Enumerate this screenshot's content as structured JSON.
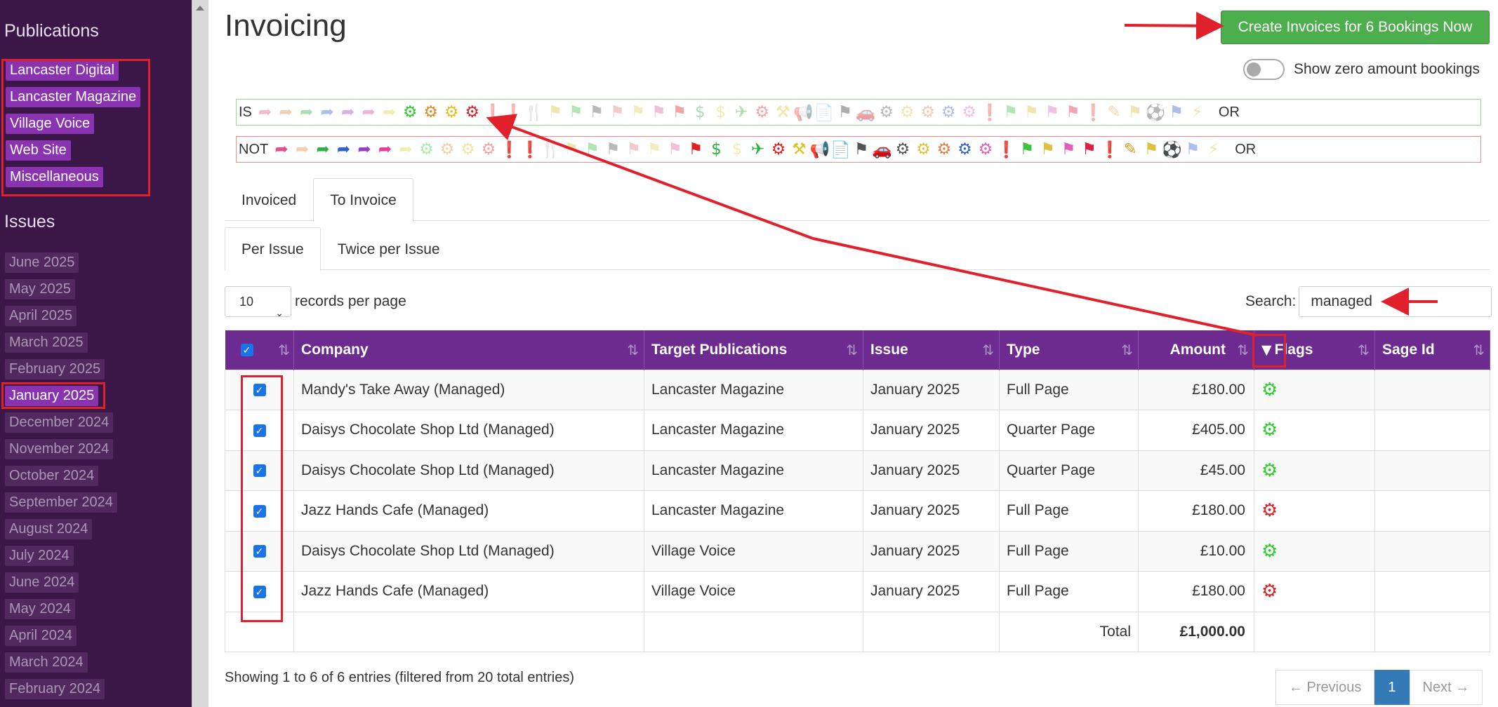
{
  "sidebar": {
    "publications_heading": "Publications",
    "publications": [
      "Lancaster Digital",
      "Lancaster Magazine",
      "Village Voice",
      "Web Site",
      "Miscellaneous"
    ],
    "issues_heading": "Issues",
    "issues": [
      "June 2025",
      "May 2025",
      "April 2025",
      "March 2025",
      "February 2025",
      "January 2025",
      "December 2024",
      "November 2024",
      "October 2024",
      "September 2024",
      "August 2024",
      "July 2024",
      "June 2024",
      "May 2024",
      "April 2024",
      "March 2024",
      "February 2024"
    ],
    "active_issue": "January 2025"
  },
  "header": {
    "title": "Invoicing",
    "create_button": "Create Invoices for 6 Bookings Now",
    "toggle_label": "Show zero amount bookings"
  },
  "flags": {
    "is_prefix": "IS",
    "not_prefix": "NOT",
    "or_label": "OR"
  },
  "tabs": {
    "primary": [
      "Invoiced",
      "To Invoice"
    ],
    "primary_active": "To Invoice",
    "secondary": [
      "Per Issue",
      "Twice per Issue"
    ],
    "secondary_active": "Per Issue"
  },
  "controls": {
    "per_page_value": "10",
    "per_page_label": "records per page",
    "search_label": "Search:",
    "search_value": "managed"
  },
  "table": {
    "columns": [
      "Company",
      "Target Publications",
      "Issue",
      "Type",
      "Amount",
      "Flags",
      "Sage Id"
    ],
    "rows": [
      {
        "company": "Mandy's Take Away (Managed)",
        "publication": "Lancaster Magazine",
        "issue": "January 2025",
        "type": "Full Page",
        "amount": "£180.00",
        "flag": "green-gears",
        "sage_id": ""
      },
      {
        "company": "Daisys Chocolate Shop Ltd (Managed)",
        "publication": "Lancaster Magazine",
        "issue": "January 2025",
        "type": "Quarter Page",
        "amount": "£405.00",
        "flag": "green-gears",
        "sage_id": ""
      },
      {
        "company": "Daisys Chocolate Shop Ltd (Managed)",
        "publication": "Lancaster Magazine",
        "issue": "January 2025",
        "type": "Quarter Page",
        "amount": "£45.00",
        "flag": "green-gears",
        "sage_id": ""
      },
      {
        "company": "Jazz Hands Cafe (Managed)",
        "publication": "Lancaster Magazine",
        "issue": "January 2025",
        "type": "Full Page",
        "amount": "£180.00",
        "flag": "red-gears",
        "sage_id": ""
      },
      {
        "company": "Daisys Chocolate Shop Ltd (Managed)",
        "publication": "Village Voice",
        "issue": "January 2025",
        "type": "Full Page",
        "amount": "£10.00",
        "flag": "green-gears",
        "sage_id": ""
      },
      {
        "company": "Jazz Hands Cafe (Managed)",
        "publication": "Village Voice",
        "issue": "January 2025",
        "type": "Full Page",
        "amount": "£180.00",
        "flag": "red-gears",
        "sage_id": ""
      }
    ],
    "total_label": "Total",
    "total_amount": "£1,000.00"
  },
  "footer": {
    "info": "Showing 1 to 6 of 6 entries (filtered from 20 total entries)",
    "prev": "← Previous",
    "page": "1",
    "next": "Next →"
  },
  "colors": {
    "sidebar_bg": "#3a1747",
    "accent_purple": "#6b2b8f",
    "pub_badge": "#8a33b0",
    "create_green": "#4cae4c",
    "annotation_red": "#e0202a",
    "pager_active": "#337ab7"
  }
}
